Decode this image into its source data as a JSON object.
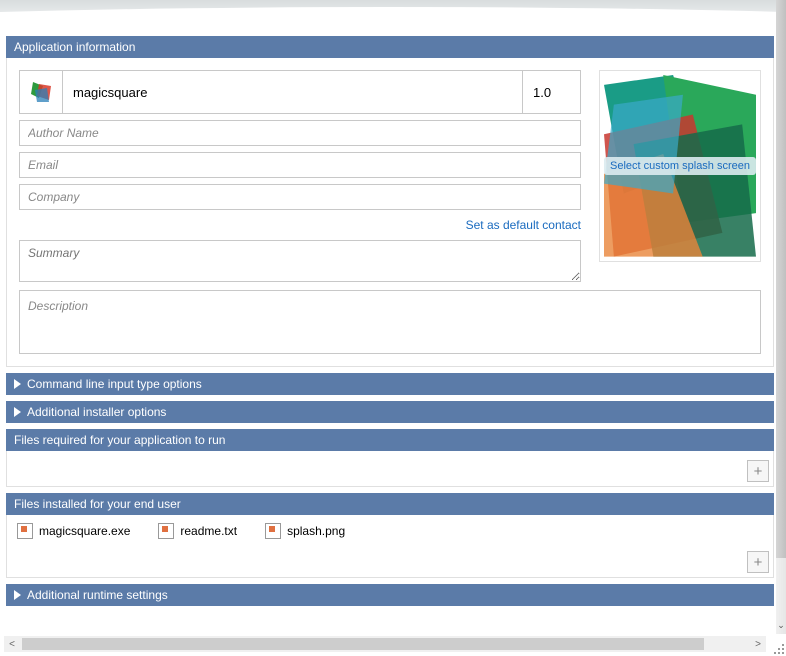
{
  "sections": {
    "app_info_title": "Application information",
    "cmd_line": "Command line input type options",
    "installer_opts": "Additional installer options",
    "files_required": "Files required for your application to run",
    "files_installed": "Files installed for your end user",
    "runtime": "Additional runtime settings"
  },
  "app": {
    "name": "magicsquare",
    "version": "1.0",
    "author_ph": "Author Name",
    "email_ph": "Email",
    "company_ph": "Company",
    "default_contact_link": "Set as default contact",
    "summary_ph": "Summary",
    "description_ph": "Description"
  },
  "splash": {
    "label": "Select custom splash screen"
  },
  "files": [
    {
      "name": "magicsquare.exe"
    },
    {
      "name": "readme.txt"
    },
    {
      "name": "splash.png"
    }
  ],
  "icons": {
    "add": "+"
  }
}
